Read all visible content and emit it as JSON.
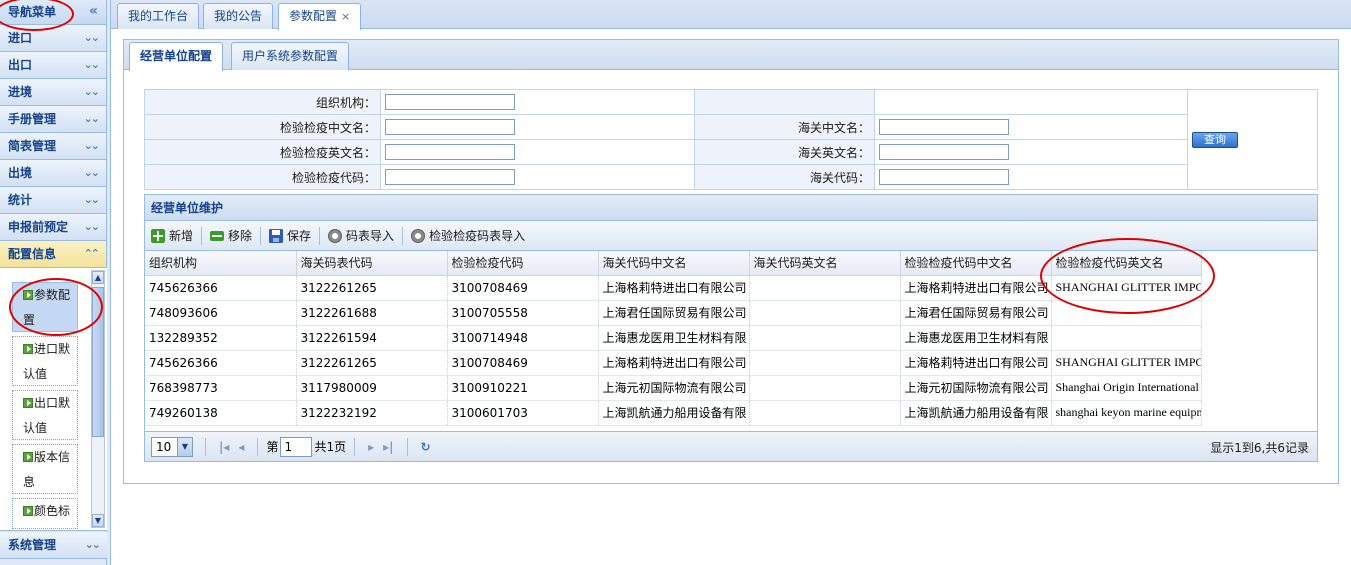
{
  "sidebar": {
    "title": "导航菜单",
    "title_chevron": "«",
    "items": [
      {
        "label": "进口"
      },
      {
        "label": "出口"
      },
      {
        "label": "进境"
      },
      {
        "label": "手册管理"
      },
      {
        "label": "简表管理"
      },
      {
        "label": "出境"
      },
      {
        "label": "统计"
      },
      {
        "label": "申报前预定"
      },
      {
        "label": "配置信息"
      }
    ],
    "sub_items": [
      {
        "label": "参数配置"
      },
      {
        "label": "进口默认值"
      },
      {
        "label": "出口默认值"
      },
      {
        "label": "版本信息"
      },
      {
        "label": "颜色标识配置"
      }
    ],
    "bottom_item": {
      "label": "系统管理"
    }
  },
  "tabs": [
    {
      "label": "我的工作台"
    },
    {
      "label": "我的公告"
    },
    {
      "label": "参数配置",
      "close": "×"
    }
  ],
  "subtabs": [
    {
      "label": "经营单位配置"
    },
    {
      "label": "用户系统参数配置"
    }
  ],
  "query": {
    "labels": [
      "组织机构：",
      "检验检疫中文名：",
      "检验检疫英文名：",
      "检验检疫代码："
    ],
    "labels2": [
      "",
      "海关中文名：",
      "海关英文名：",
      "海关代码："
    ],
    "values": [
      "",
      "",
      "",
      ""
    ],
    "values2": [
      "",
      "",
      ""
    ],
    "button": "查询"
  },
  "grid": {
    "title": "经营单位维护",
    "toolbar": {
      "add": "新增",
      "remove": "移除",
      "save": "保存",
      "import_code": "码表导入",
      "import_ciq": "检验检疫码表导入"
    },
    "columns": [
      "组织机构",
      "海关码表代码",
      "检验检疫代码",
      "海关代码中文名",
      "海关代码英文名",
      "检验检疫代码中文名",
      "检验检疫代码英文名"
    ],
    "rows": [
      [
        "745626366",
        "3122261265",
        "3100708469",
        "上海格莉特进出口有限公司",
        "",
        "上海格莉特进出口有限公司",
        "SHANGHAI GLITTER IMPO"
      ],
      [
        "748093606",
        "3122261688",
        "3100705558",
        "上海君任国际贸易有限公司",
        "",
        "上海君任国际贸易有限公司",
        ""
      ],
      [
        "132289352",
        "3122261594",
        "3100714948",
        "上海惠龙医用卫生材料有限",
        "",
        "上海惠龙医用卫生材料有限",
        ""
      ],
      [
        "745626366",
        "3122261265",
        "3100708469",
        "上海格莉特进出口有限公司",
        "",
        "上海格莉特进出口有限公司",
        "SHANGHAI GLITTER IMPO"
      ],
      [
        "768398773",
        "3117980009",
        "3100910221",
        "上海元初国际物流有限公司",
        "",
        "上海元初国际物流有限公司",
        "Shanghai Origin International L"
      ],
      [
        "749260138",
        "3122232192",
        "3100601703",
        "上海凯航通力船用设备有限",
        "",
        "上海凯航通力船用设备有限",
        "shanghai keyon marine equipm"
      ]
    ],
    "pager": {
      "page_size": "10",
      "page_prefix": "第",
      "page": "1",
      "page_suffix": "共1页",
      "info": "显示1到6,共6记录"
    }
  },
  "colors": {
    "accent": "#15428b",
    "border": "#99bbe8",
    "annotation": "#e00000"
  }
}
